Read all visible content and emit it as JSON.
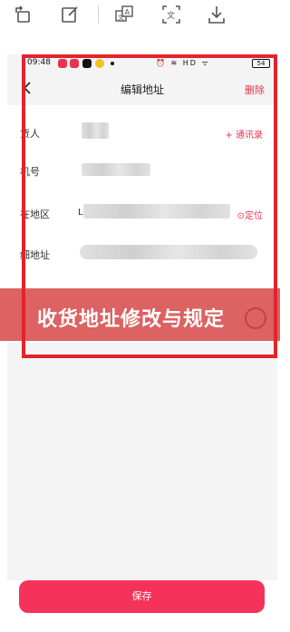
{
  "toolbar": {
    "icons": [
      "rotate-icon",
      "edit-icon",
      "translate-icon",
      "text-recognition-icon",
      "download-icon"
    ]
  },
  "statusbar": {
    "time": "09:48",
    "indicators": "⏰ ≋ HD ᯤ",
    "battery": "54"
  },
  "nav": {
    "title": "编辑地址",
    "delete_label": "删除"
  },
  "form": {
    "recipient_label": "货人",
    "contacts_link": "+ 通讯录",
    "phone_label": "机号",
    "region_label": "在地区",
    "region_prefix": "L",
    "locate_link": "⊙定位",
    "detail_label": "细地址"
  },
  "banner": {
    "text": "收货地址修改与规定"
  },
  "footer": {
    "save_label": "保存"
  },
  "colors": {
    "accent": "#e8344e",
    "save_button": "#f5335a",
    "highlight_box": "#e2242c",
    "banner": "#d64040"
  }
}
